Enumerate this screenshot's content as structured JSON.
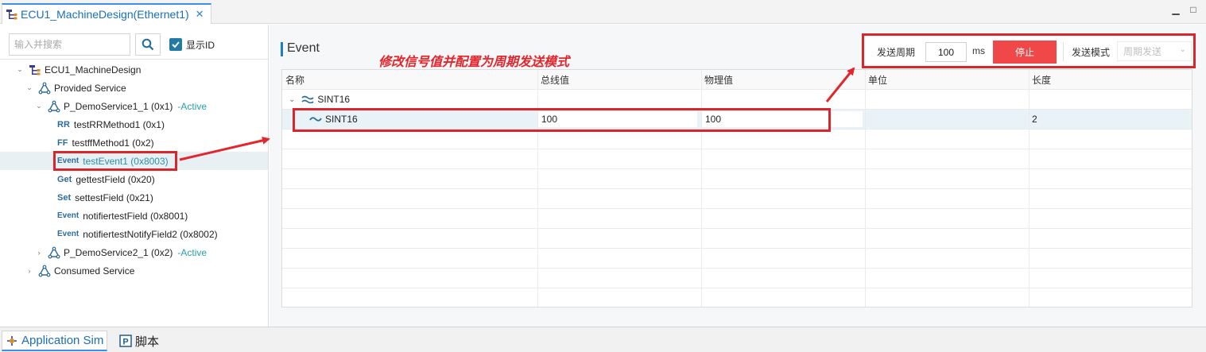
{
  "editor_tab": {
    "title": "ECU1_MachineDesign(Ethernet1)",
    "close": "✕"
  },
  "window_controls": {
    "minimize": "▁",
    "maximize": "□"
  },
  "left": {
    "search_placeholder": "输入并搜索",
    "show_id_label": "显示ID",
    "show_id_checked": true,
    "tree": {
      "root": "ECU1_MachineDesign",
      "provided": "Provided Service",
      "service1": "P_DemoService1_1 (0x1)",
      "service1_status": "-Active",
      "methods": [
        {
          "icon": "RR",
          "label": "testRRMethod1 (0x1)"
        },
        {
          "icon": "FF",
          "label": "testffMethod1 (0x2)"
        },
        {
          "icon": "Event",
          "label": "testEvent1 (0x8003)"
        },
        {
          "icon": "Get",
          "label": "gettestField (0x20)"
        },
        {
          "icon": "Set",
          "label": "settestField (0x21)"
        },
        {
          "icon": "Event",
          "label": "notifiertestField (0x8001)"
        },
        {
          "icon": "Event",
          "label": "notifiertestNotifyField2 (0x8002)"
        }
      ],
      "service2": "P_DemoService2_1 (0x2)",
      "service2_status": "-Active",
      "consumed": "Consumed Service"
    }
  },
  "right": {
    "title": "Event",
    "annotation": "修改信号值并配置为周期发送模式",
    "controls": {
      "period_label": "发送周期",
      "period_value": "100",
      "unit": "ms",
      "stop_label": "停止",
      "mode_label": "发送模式",
      "mode_value": "周期发送"
    },
    "grid": {
      "headers": [
        "名称",
        "总线值",
        "物理值",
        "单位",
        "长度"
      ],
      "parent_row": {
        "name": "SINT16"
      },
      "child_row": {
        "name": "SINT16",
        "bus_value": "100",
        "phys_value": "100",
        "unit": "",
        "length": "2"
      }
    }
  },
  "bottom_tabs": [
    {
      "label": "Application Sim"
    },
    {
      "label": "脚本"
    }
  ],
  "colors": {
    "accent": "#1e7fc0",
    "stop_red": "#f04848",
    "annot_red": "#e2262c",
    "active_teal": "#29a0a3"
  }
}
